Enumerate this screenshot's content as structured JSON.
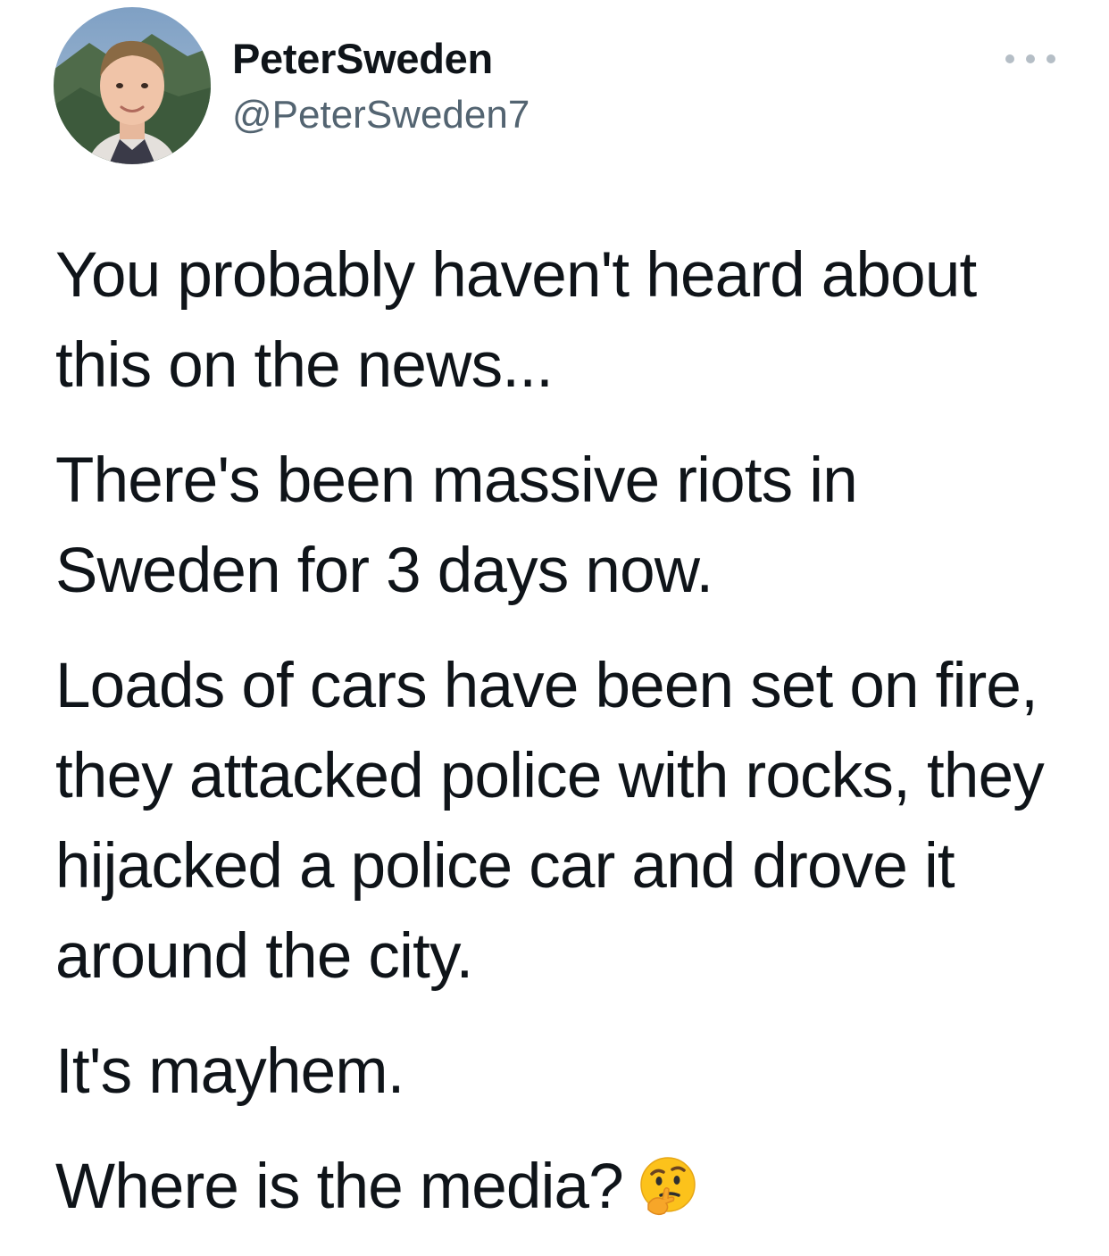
{
  "tweet": {
    "author": {
      "display_name": "PeterSweden",
      "handle": "@PeterSweden7"
    },
    "more_icon": "more-horizontal-icon",
    "paragraphs": [
      [
        "You probably haven't heard about",
        "this on the news..."
      ],
      [
        "There's been massive riots in",
        "Sweden for 3 days now."
      ],
      [
        "Loads of cars have been set on fire,",
        "they attacked police with rocks, they",
        "hijacked a police car and drove it",
        "around the city."
      ],
      [
        "It's mayhem."
      ],
      [
        "Where is the media?"
      ]
    ],
    "trailing_emoji": "thinking-face-emoji"
  },
  "colors": {
    "text": "#0f1419",
    "secondary": "#536471",
    "more_dots": "#b5bec6"
  }
}
